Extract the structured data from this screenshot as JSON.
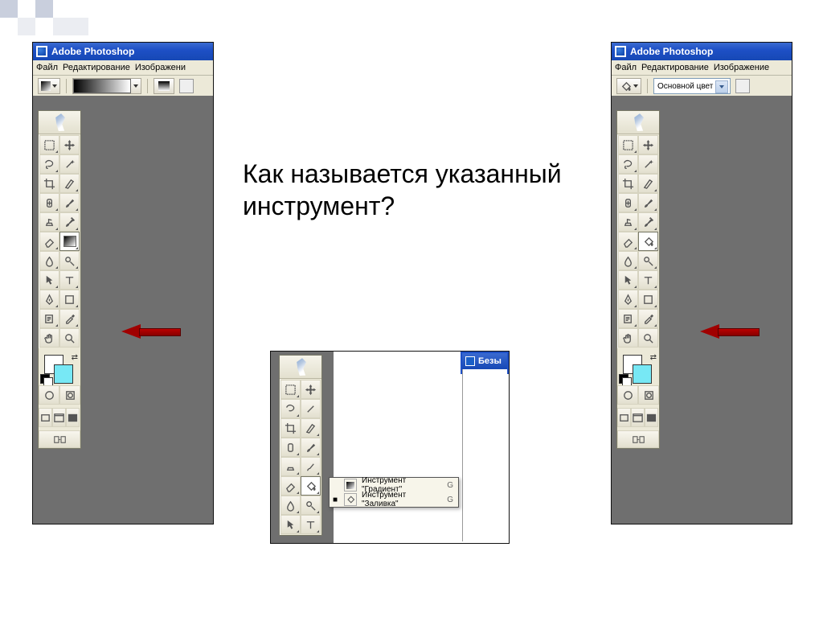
{
  "question_line1": "Как называется указанный",
  "question_line2": "инструмент?",
  "app_title": "Adobe Photoshop",
  "menus": {
    "file": "Файл",
    "edit": "Редактирование",
    "image_trunc": "Изображени",
    "image": "Изображение"
  },
  "opt_right": {
    "combo_label": "Основной цвет"
  },
  "flyout": {
    "row1": {
      "label": "Инструмент \"Градиент\"",
      "shortcut": "G"
    },
    "row2": {
      "label": "Инструмент \"Заливка\"",
      "shortcut": "G"
    }
  },
  "mid_title": "Безы",
  "tools": {
    "marquee": "marquee",
    "move": "move",
    "lasso": "lasso",
    "wand": "wand",
    "crop": "crop",
    "slice": "slice",
    "heal": "heal",
    "brush": "brush",
    "stamp": "stamp",
    "history": "history",
    "eraser": "eraser",
    "gradient": "gradient",
    "blur": "blur",
    "dodge": "dodge",
    "path": "path",
    "type": "type",
    "pen": "pen",
    "shape": "shape",
    "notes": "notes",
    "eyedrop": "eyedrop",
    "hand": "hand",
    "zoom": "zoom",
    "bucket": "bucket"
  }
}
